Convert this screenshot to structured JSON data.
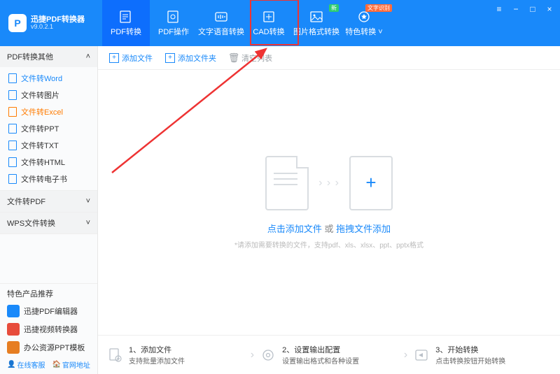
{
  "app": {
    "title": "迅捷PDF转换器",
    "version": "v9.0.2.1"
  },
  "tabs": [
    {
      "id": "pdf-convert",
      "label": "PDF转换"
    },
    {
      "id": "pdf-operate",
      "label": "PDF操作"
    },
    {
      "id": "text-voice",
      "label": "文字语音转换"
    },
    {
      "id": "cad-convert",
      "label": "CAD转换"
    },
    {
      "id": "image-format",
      "label": "图片格式转换",
      "badge_new": "新"
    },
    {
      "id": "special",
      "label": "特色转换",
      "badge_ocr": "文字识别",
      "dropdown": true
    }
  ],
  "sidebar": {
    "group1": {
      "head": "PDF转换其他",
      "chev": "˄",
      "items": [
        {
          "label": "文件转Word",
          "link": true
        },
        {
          "label": "文件转图片"
        },
        {
          "label": "文件转Excel",
          "selected": true
        },
        {
          "label": "文件转PPT"
        },
        {
          "label": "文件转TXT"
        },
        {
          "label": "文件转HTML"
        },
        {
          "label": "文件转电子书"
        }
      ]
    },
    "group2": {
      "head": "文件转PDF",
      "chev": "˅"
    },
    "group3": {
      "head": "WPS文件转换",
      "chev": "˅"
    },
    "reco": {
      "head": "特色产品推荐",
      "items": [
        {
          "label": "迅捷PDF编辑器",
          "color": "#1989fa"
        },
        {
          "label": "迅捷视频转换器",
          "color": "#e74c3c"
        },
        {
          "label": "办公资源PPT模板",
          "color": "#e67e22"
        }
      ]
    },
    "foot": {
      "kf": "在线客服",
      "site": "官网地址"
    }
  },
  "toolbar": {
    "add_file": "添加文件",
    "add_folder": "添加文件夹",
    "clear_list": "清空列表"
  },
  "drop": {
    "click_add": "点击添加文件",
    "or": " 或 ",
    "drag_add": "拖拽文件添加",
    "sub": "*请添加需要转换的文件，支持pdf、xls、xlsx、ppt、pptx格式"
  },
  "steps": {
    "s1": {
      "t": "1、添加文件",
      "d": "支持批量添加文件"
    },
    "s2": {
      "t": "2、设置输出配置",
      "d": "设置输出格式和各种设置"
    },
    "s3": {
      "t": "3、开始转换",
      "d": "点击转换按钮开始转换"
    }
  }
}
